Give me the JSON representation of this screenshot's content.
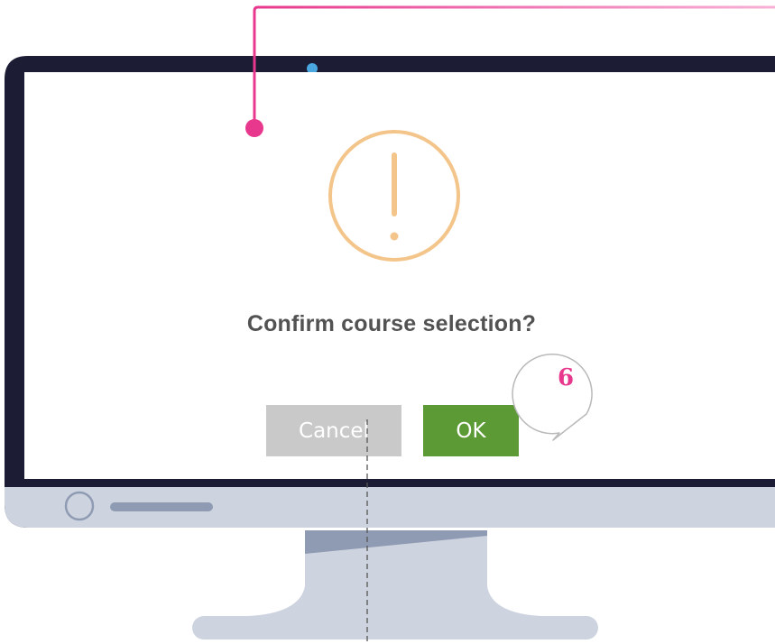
{
  "dialog": {
    "title": "Confirm course selection?",
    "cancel_label": "Cancel",
    "ok_label": "OK",
    "icon": "warning-icon"
  },
  "annotation": {
    "step_number": "6",
    "callout_color": "#e8388e"
  },
  "colors": {
    "monitor_bezel": "#1c1d35",
    "monitor_chin": "#ced4df",
    "warning_icon": "#f4c58a",
    "title_text": "#525252",
    "cancel_button": "#c9c9c9",
    "ok_button": "#5b9a34",
    "camera": "#4aa7e0"
  }
}
